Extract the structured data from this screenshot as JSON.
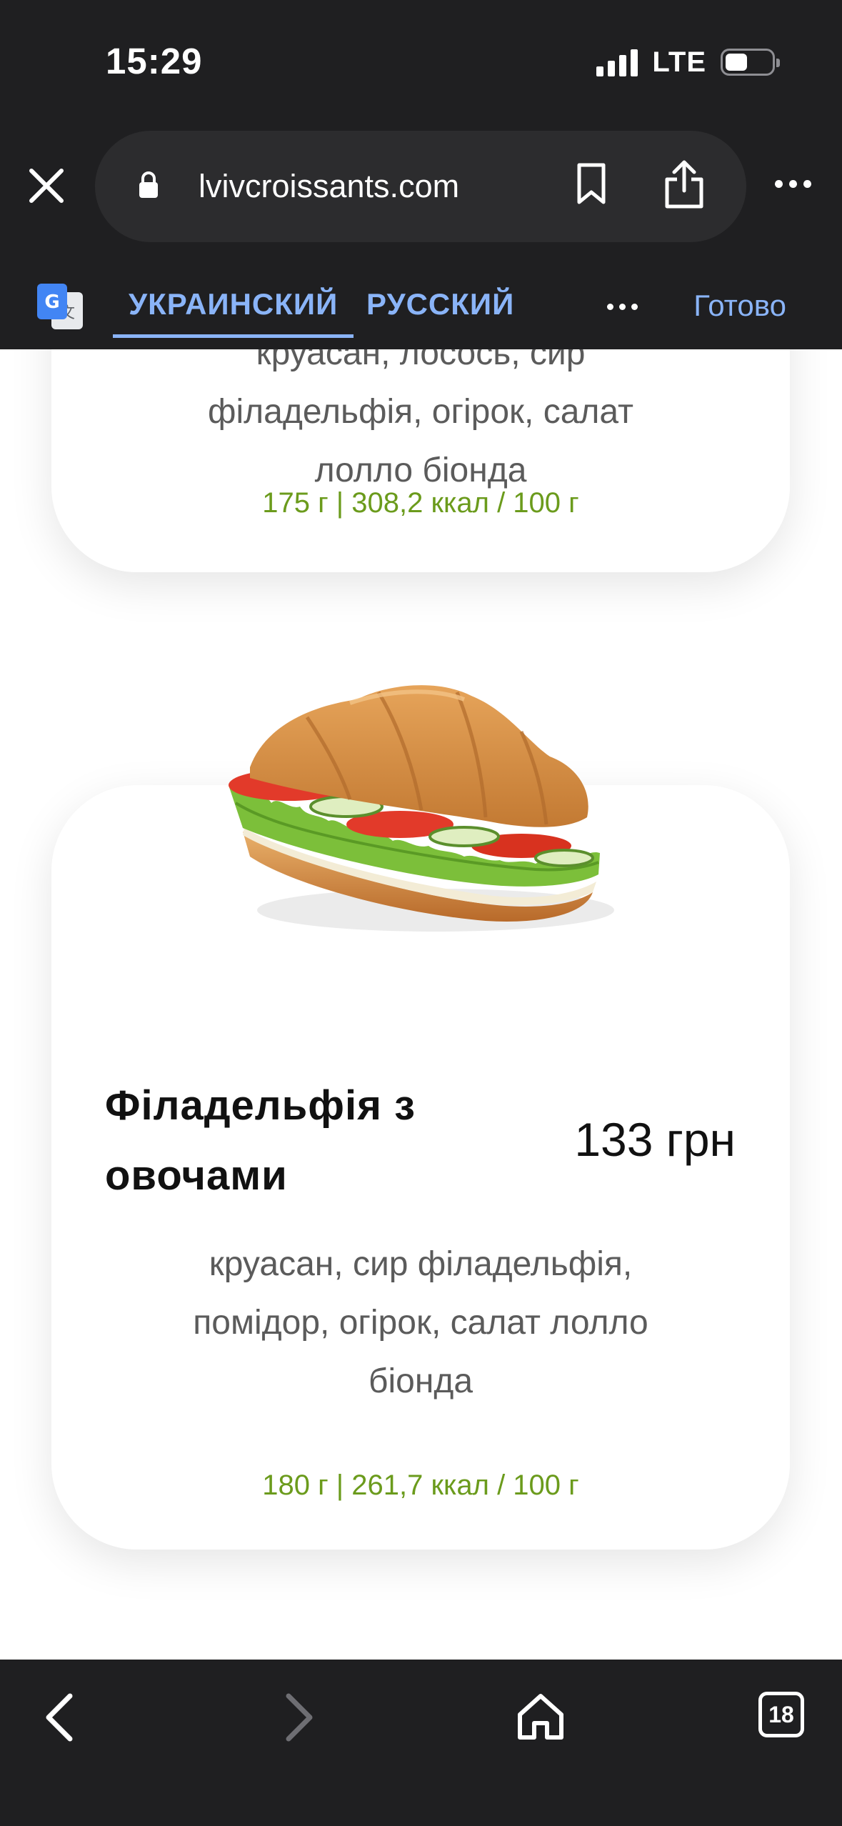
{
  "status_bar": {
    "time": "15:29",
    "network": "LTE"
  },
  "browser": {
    "url": "lvivcroissants.com"
  },
  "translate_bar": {
    "lang_active": "УКРАИНСКИЙ",
    "lang_target": "РУССКИЙ",
    "done_label": "Готово"
  },
  "products": [
    {
      "description": "круасан, лосось, сир філадельфія, огірок, салат лолло біонда",
      "nutrition": "175 г | 308,2 ккал / 100 г"
    },
    {
      "name": "Філадельфія з овочами",
      "price": "133 грн",
      "description": "круасан, сир філадельфія, помідор, огірок, салат лолло біонда",
      "nutrition": "180 г | 261,7 ккал / 100 г"
    }
  ],
  "bottom_nav": {
    "tab_count": "18"
  },
  "colors": {
    "chrome_bg": "#1f1f21",
    "accent_blue": "#8ab4f8",
    "nutrition_green": "#6b9b1c"
  }
}
